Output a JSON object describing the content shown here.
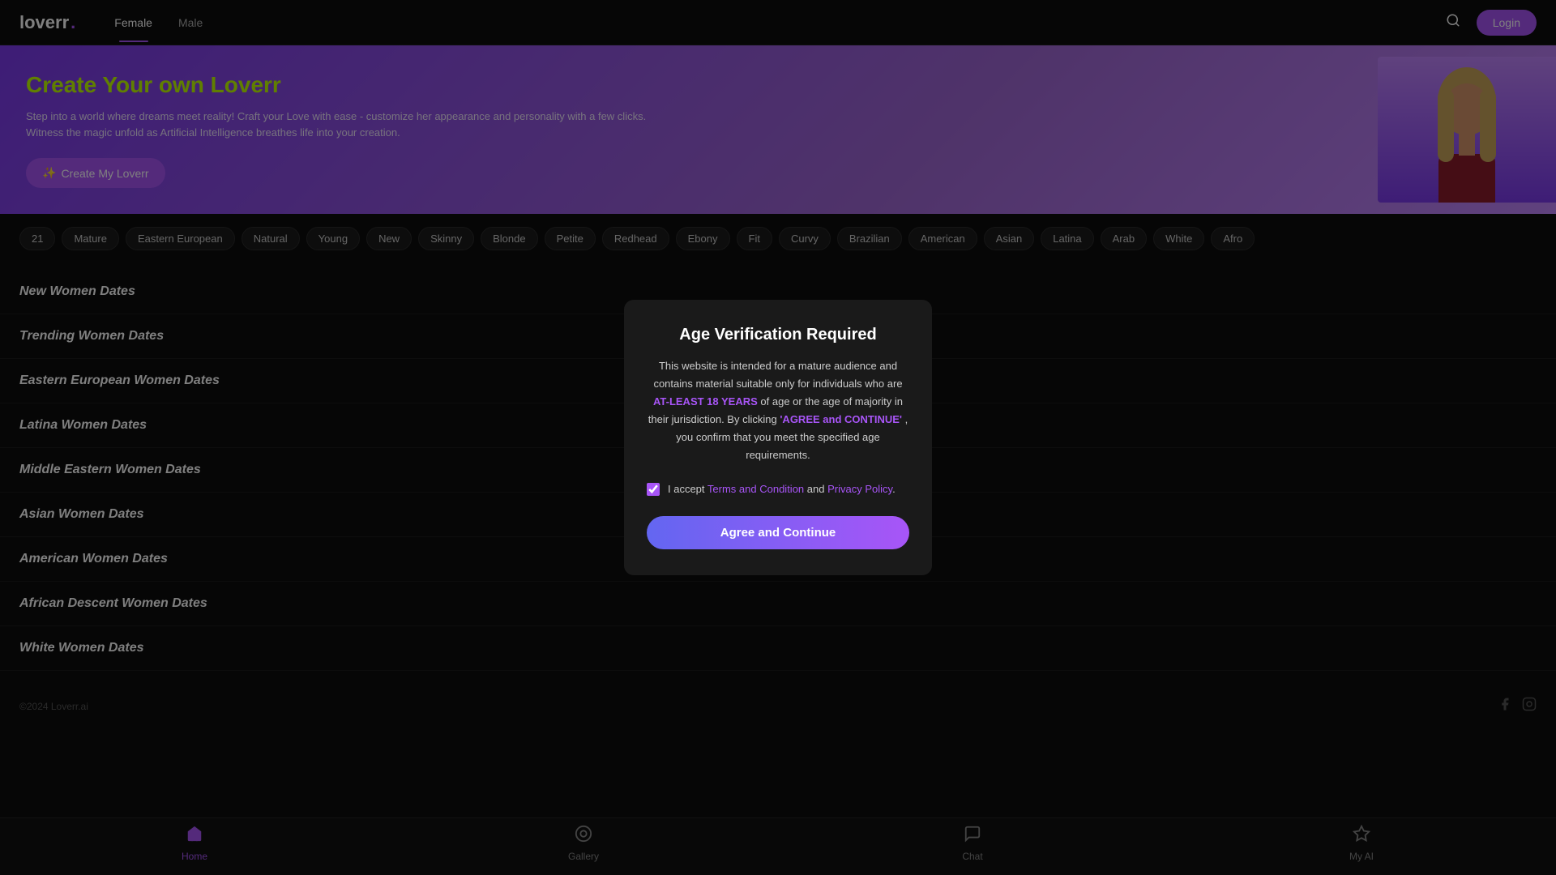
{
  "header": {
    "logo": "loverr",
    "logo_dot": ".",
    "nav_tabs": [
      {
        "label": "Female",
        "active": true
      },
      {
        "label": "Male",
        "active": false
      }
    ],
    "login_label": "Login"
  },
  "hero": {
    "title": "Create Your own Loverr",
    "subtitle": "Step into a world where dreams meet reality! Craft your Love with ease - customize her appearance and personality with a few clicks. Witness the magic unfold as Artificial Intelligence breathes life into your creation.",
    "button_label": "Create My Loverr",
    "button_icon": "✨"
  },
  "tags": [
    "21",
    "Mature",
    "Eastern European",
    "Natural",
    "Young",
    "New",
    "Skinny",
    "Blonde",
    "Petite",
    "Redhead",
    "Ebony",
    "Fit",
    "Curvy",
    "Brazilian",
    "American",
    "Asian",
    "Latina",
    "Arab",
    "White",
    "Afro"
  ],
  "sections": [
    {
      "label": "New Women Dates"
    },
    {
      "label": "Trending Women Dates"
    },
    {
      "label": "Eastern European Women Dates"
    },
    {
      "label": "Latina Women Dates"
    },
    {
      "label": "Middle Eastern Women Dates"
    },
    {
      "label": "Asian Women Dates"
    },
    {
      "label": "American Women Dates"
    },
    {
      "label": "African Descent Women Dates"
    },
    {
      "label": "White Women Dates"
    }
  ],
  "modal": {
    "title": "Age Verification Required",
    "body_1": "This website is intended for a mature audience and contains material suitable only for individuals who are",
    "highlight_age": "AT-LEAST 18 YEARS",
    "body_2": "of age or the age of majority in their jurisdiction. By clicking",
    "highlight_link": "'AGREE and CONTINUE'",
    "body_3": ", you confirm that you meet the specified age requirements.",
    "checkbox_prefix": "I accept",
    "terms_label": "Terms and Condition",
    "and_label": "and",
    "privacy_label": "Privacy Policy",
    "checkbox_suffix": ".",
    "agree_button": "Agree and Continue"
  },
  "footer": {
    "copyright": "©2024 Loverr.ai"
  },
  "bottom_nav": [
    {
      "icon": "🏠",
      "label": "Home",
      "active": true
    },
    {
      "icon": "◎",
      "label": "Gallery",
      "active": false
    },
    {
      "icon": "💬",
      "label": "Chat",
      "active": false
    },
    {
      "icon": "✦",
      "label": "My AI",
      "active": false
    }
  ]
}
